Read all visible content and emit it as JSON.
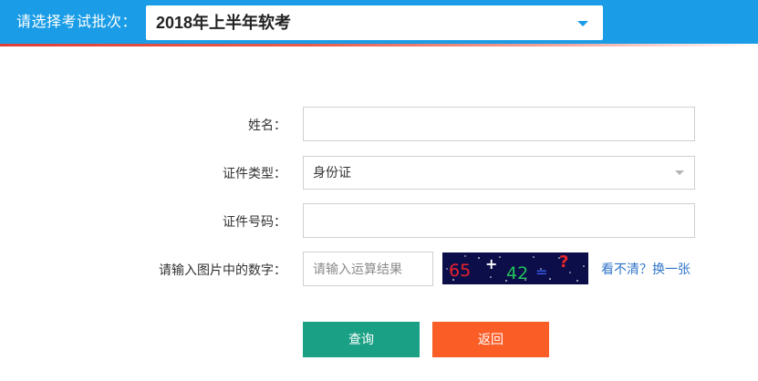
{
  "header": {
    "batch_label": "请选择考试批次：",
    "batch_value": "2018年上半年软考",
    "bar_color": "#1a9de6",
    "caret_icon": "triangle-down-icon"
  },
  "form": {
    "name_label": "姓名：",
    "name_value": "",
    "id_type_label": "证件类型：",
    "id_type_value": "身份证",
    "id_number_label": "证件号码：",
    "id_number_value": "",
    "captcha_label": "请输入图片中的数字：",
    "captcha_placeholder": "请输入运算结果",
    "captcha_image": {
      "num1": "65",
      "op": "+",
      "num2": "42",
      "eq": "=",
      "q": "?"
    },
    "refresh_link": "看不清？换一张"
  },
  "buttons": {
    "query_label": "查询",
    "back_label": "返回",
    "query_color": "#1aa084",
    "back_color": "#fb5d27"
  }
}
